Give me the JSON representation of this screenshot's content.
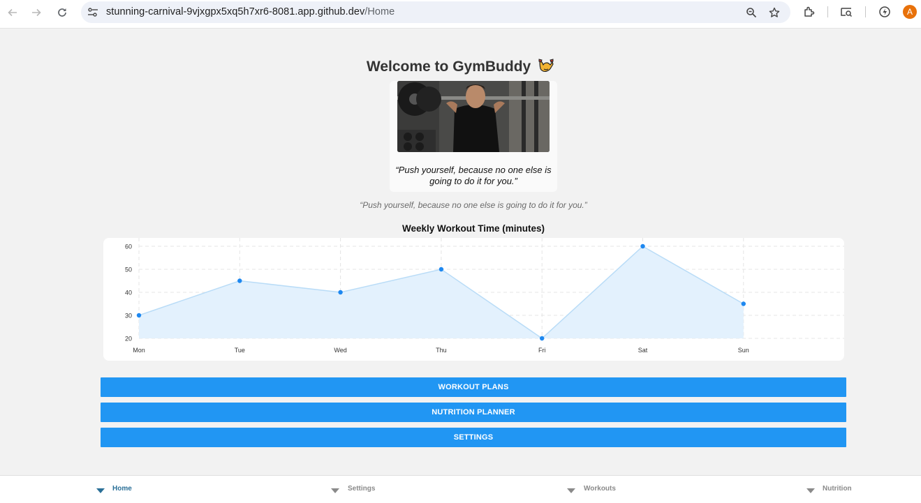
{
  "browser": {
    "url_host": "stunning-carnival-9vjxgpx5xq5h7xr6-8081.app.github.dev",
    "url_path": "/Home",
    "avatar_letter": "A"
  },
  "page": {
    "title": "Welcome to GymBuddy",
    "title_icon": "flexed-biceps-emoji",
    "card_quote": "“Push yourself, because no one else is going to do it for you.”",
    "sub_quote": "“Push yourself, because no one else is going to do it for you.”"
  },
  "chart_data": {
    "type": "line",
    "title": "Weekly Workout Time (minutes)",
    "categories": [
      "Mon",
      "Tue",
      "Wed",
      "Thu",
      "Fri",
      "Sat",
      "Sun"
    ],
    "values": [
      30,
      45,
      40,
      50,
      20,
      60,
      35
    ],
    "ylim": [
      20,
      60
    ],
    "yticks": [
      "20",
      "30",
      "40",
      "50",
      "60"
    ],
    "fill": "area",
    "grid": true,
    "line_color": "#b9dcf7",
    "fill_color": "#e3f1fd",
    "point_color": "#1e88f0"
  },
  "menu": {
    "workout_plans": "WORKOUT PLANS",
    "nutrition_planner": "NUTRITION PLANNER",
    "settings": "SETTINGS"
  },
  "tabs": [
    {
      "label": "Home",
      "active": true
    },
    {
      "label": "Settings",
      "active": false
    },
    {
      "label": "Workouts",
      "active": false
    },
    {
      "label": "Nutrition",
      "active": false
    }
  ],
  "colors": {
    "accent": "#2196f3",
    "active_tab": "#2a6f97"
  }
}
